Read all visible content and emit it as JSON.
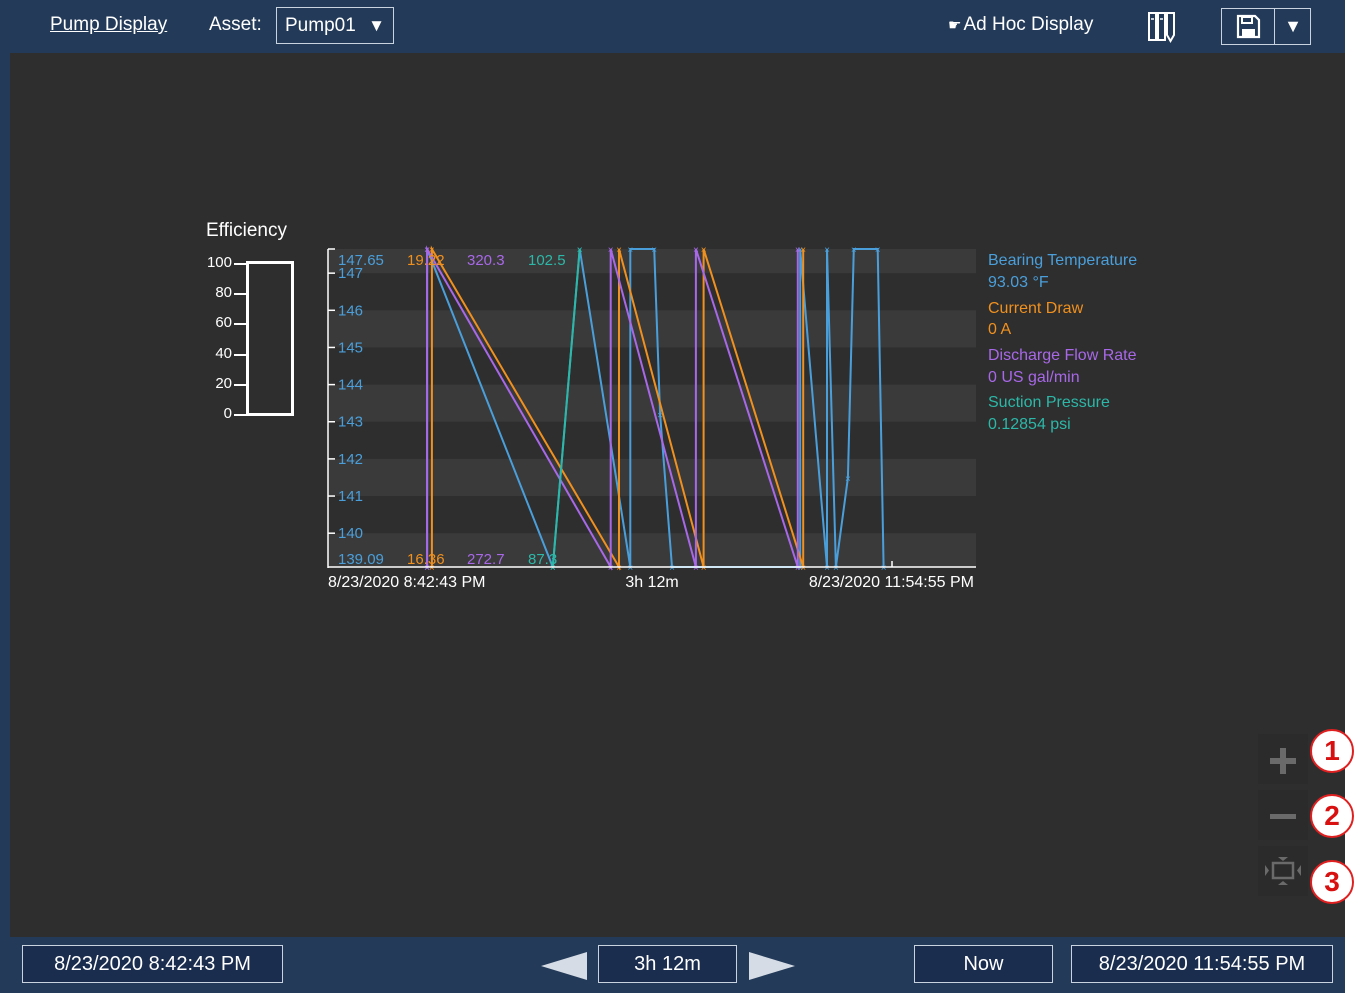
{
  "topbar": {
    "title": "Pump Display",
    "asset_label": "Asset:",
    "asset_value": "Pump01",
    "adhoc_label": "Ad Hoc Display"
  },
  "efficiency": {
    "title": "Efficiency",
    "ticks": [
      "100",
      "80",
      "60",
      "40",
      "20",
      "0"
    ]
  },
  "trend": {
    "start_time": "8/23/2020 8:42:43 PM",
    "duration": "3h 12m",
    "end_time": "8/23/2020 11:54:55 PM",
    "scale_max": {
      "bearing": "147.65",
      "current": "19.22",
      "flow": "320.3",
      "suction": "102.5"
    },
    "scale_min": {
      "bearing": "139.09",
      "current": "16.36",
      "flow": "272.7",
      "suction": "87.3"
    },
    "legend": [
      {
        "name": "Bearing Temperature",
        "value": "93.03 °F",
        "color": "#4a9fdb"
      },
      {
        "name": "Current Draw",
        "value": "0 A",
        "color": "#f0901e"
      },
      {
        "name": "Discharge Flow Rate",
        "value": "0 US gal/min",
        "color": "#a868e8"
      },
      {
        "name": "Suction Pressure",
        "value": "0.12854 psi",
        "color": "#2cb8a8"
      }
    ]
  },
  "chart_data": {
    "type": "line",
    "x_start": "8/23/2020 8:42:43 PM",
    "x_end": "8/23/2020 11:54:55 PM",
    "y_ticks": [
      147,
      146,
      145,
      144,
      143,
      142,
      141,
      140
    ],
    "ylim": [
      139.09,
      147.65
    ],
    "series": [
      {
        "name": "Bearing Temperature",
        "color": "#4a9fdb",
        "points": [
          [
            0.079,
            0
          ],
          [
            0.079,
            1
          ],
          [
            0.29,
            0
          ],
          [
            0.335,
            1
          ],
          [
            0.42,
            0
          ],
          [
            0.42,
            1
          ],
          [
            0.46,
            1
          ],
          [
            0.47,
            0.48
          ],
          [
            0.49,
            0
          ],
          [
            0.705,
            0
          ],
          [
            0.705,
            1
          ],
          [
            0.75,
            0
          ],
          [
            0.75,
            1
          ],
          [
            0.765,
            0
          ],
          [
            0.785,
            0.28
          ],
          [
            0.795,
            1
          ],
          [
            0.835,
            1
          ],
          [
            0.845,
            0
          ]
        ]
      },
      {
        "name": "Current Draw",
        "color": "#f0901e",
        "points": [
          [
            0.087,
            0
          ],
          [
            0.087,
            1
          ],
          [
            0.401,
            0
          ],
          [
            0.401,
            1
          ],
          [
            0.543,
            0
          ],
          [
            0.543,
            1
          ],
          [
            0.71,
            0
          ],
          [
            0.71,
            1
          ]
        ]
      },
      {
        "name": "Discharge Flow Rate",
        "color": "#a868e8",
        "points": [
          [
            0.079,
            0
          ],
          [
            0.079,
            1
          ],
          [
            0.387,
            0
          ],
          [
            0.387,
            1
          ],
          [
            0.53,
            0
          ],
          [
            0.53,
            1
          ],
          [
            0.701,
            0
          ],
          [
            0.701,
            1
          ]
        ]
      },
      {
        "name": "Suction Pressure",
        "color": "#2cb8a8",
        "points": [
          [
            0.29,
            0
          ],
          [
            0.335,
            1
          ]
        ]
      }
    ]
  },
  "zoom": {
    "zoom_in_callout": "1",
    "zoom_out_callout": "2",
    "fit_callout": "3"
  },
  "timebar": {
    "start": "8/23/2020 8:42:43 PM",
    "duration": "3h 12m",
    "now_label": "Now",
    "end": "8/23/2020 11:54:55 PM"
  }
}
